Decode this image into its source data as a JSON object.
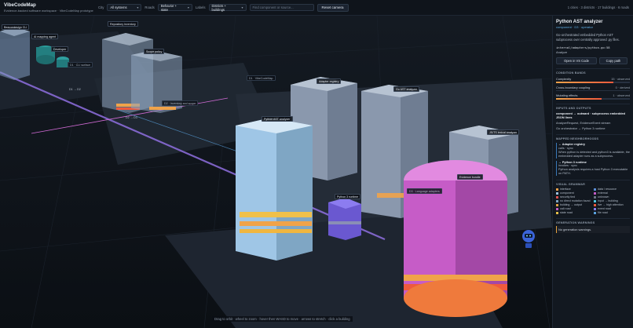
{
  "app": {
    "title": "VibeCodeMap",
    "subtitle": "Evidence-backed software workspace · VibeCodeMap prototype"
  },
  "toolbar": {
    "city_label": "City",
    "city_value": "All systems",
    "roads_label": "Roads",
    "roads_value": "Behavior + state",
    "labels_label": "Labels",
    "labels_value": "Districts + buildings",
    "search_placeholder": "Find component or source...",
    "reset_label": "Reset camera",
    "stats": "1 cities · 3 districts · 17 buildings · 6 roads"
  },
  "scene": {
    "district_labels": [
      "D1 · CLI surface",
      "D2 · Inventory and scope",
      "D1 · VibeCodeMap",
      "D3 · Language adapters"
    ],
    "building_labels": [
      "Beacondesign CLI",
      "AI mapping agent",
      "Developer",
      "Repository inventory",
      "Scope policy",
      "Adapter registry",
      "Go AST analyzer",
      "Python AST analyzer",
      "JS/TS lexical analyzer",
      "Evidence bundle",
      "Python 3 runtime"
    ],
    "road_labels": [
      "D1 → D2",
      "D2 → D3"
    ],
    "hint": "Drag to orbit · wheel to zoom · hover then WASD to move · arrows to stretch · click a building"
  },
  "panel": {
    "title": "Python AST analyzer",
    "subtitle": "component · D3 · operator",
    "description": "Go-orchestrated embedded Python AST subprocess over centrally approved .py files.",
    "path": "internal/adapters/python.go:58",
    "path_caption": "Analyze",
    "open_button": "Open in VS Code",
    "copy_button": "Copy path",
    "bands_heading": "CONDITION BANDS",
    "bands": [
      {
        "name": "Complexity",
        "value": "15 · observed",
        "level": 0.78
      },
      {
        "name": "Cross-boundary coupling",
        "value": "0 · derived",
        "level": 0.0
      },
      {
        "name": "Mutating effects",
        "value": "1 · observed",
        "level": 0.62
      }
    ],
    "io_heading": "INPUTS AND OUTPUTS",
    "io_line1": "component → outward · subprocess embedded JSON lines",
    "io_line2": "AnalyzeRequest, EvidenceEvent stream",
    "io_line3": "Go orchestrator → Python 3 runtime",
    "neighbors_heading": "MAPPED NEIGHBORHOODS",
    "neighbors": [
      {
        "title": "← Adapter registry",
        "meta": "calls · sync",
        "text": "When python is detected and python3 is available, the embedded adapter runs as a subprocess."
      },
      {
        "title": "→ Python 3 runtime",
        "meta": "invokes · sync",
        "text": "Python analysis requires a host Python 3 executable on PATH."
      }
    ],
    "grammar_heading": "VISUAL GRAMMAR",
    "grammar": [
      {
        "label": "interface",
        "color": "#f0a34a"
      },
      {
        "label": "data / resource",
        "color": "#5b8fd9"
      },
      {
        "label": "component",
        "color": "#9fc3df"
      },
      {
        "label": "external",
        "color": "#c65cc7"
      },
      {
        "label": "security tied",
        "color": "#e05050"
      },
      {
        "label": "unknown",
        "color": "#6a7585"
      },
      {
        "label": "no direct mutation found",
        "color": "#7fa6c4"
      },
      {
        "label": "input → building",
        "color": "#4fc6e0"
      },
      {
        "label": "building → output",
        "color": "#e0a040"
      },
      {
        "label": "live → high attention",
        "color": "#ef5a3c"
      },
      {
        "label": "call road",
        "color": "#c65cc7"
      },
      {
        "label": "event road",
        "color": "#8a7df0"
      },
      {
        "label": "state road",
        "color": "#e8c14a"
      },
      {
        "label": "file road",
        "color": "#5aa3e0"
      }
    ],
    "warnings_heading": "GENERATION WARNINGS",
    "warning_text": "No generation warnings."
  }
}
